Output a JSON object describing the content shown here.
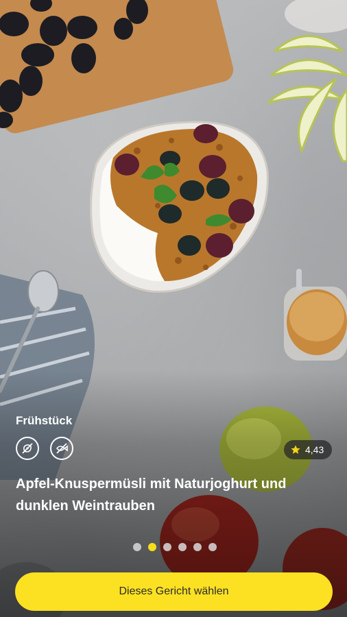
{
  "recipe": {
    "category": "Frühstück",
    "rating": "4,43",
    "title": "Apfel-Knuspermüsli mit Naturjoghurt und dunklen Weintrauben",
    "diet_icons": [
      "no-meat-icon",
      "no-fish-icon"
    ]
  },
  "carousel": {
    "pages": 6,
    "active_index": 1
  },
  "cta": {
    "label": "Dieses Gericht wählen"
  },
  "colors": {
    "accent": "#fbe122",
    "dot_active": "#f6dd19",
    "dot_inactive": "#d9d9d9",
    "rating_bg": "#2f2f2f",
    "star": "#f6d21a"
  }
}
